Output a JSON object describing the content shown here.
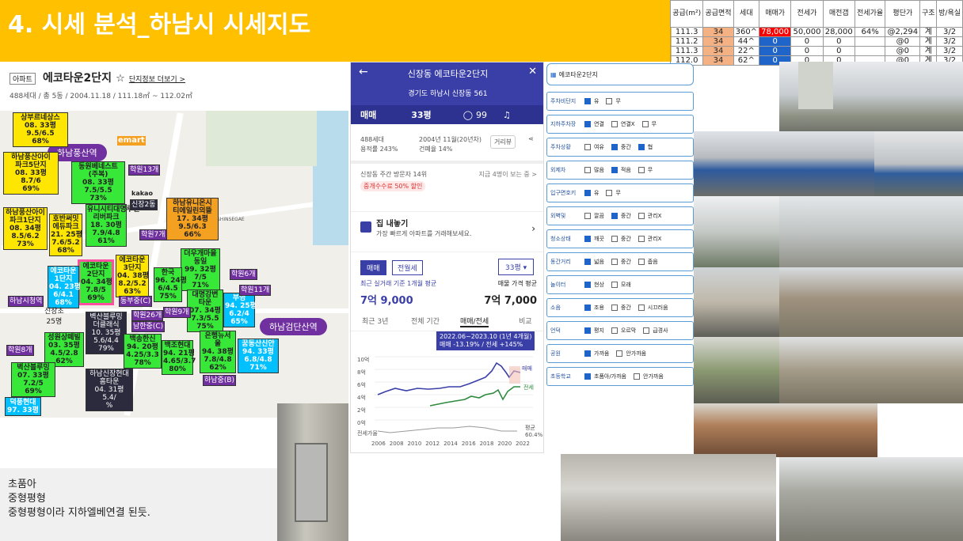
{
  "title": "4. 시세 분석_하남시 시세지도",
  "table": {
    "headers": [
      "공급(m²)",
      "공급면적",
      "세대",
      "매매가",
      "전세가",
      "매전갭",
      "전세가율",
      "평단가",
      "구조",
      "방/욕실"
    ],
    "rows": [
      [
        "111.3",
        "34",
        "360^",
        "78,000",
        "50,000",
        "28,000",
        "64%",
        "@2,294",
        "계",
        "3/2"
      ],
      [
        "111.2",
        "34",
        "44^",
        "0",
        "0",
        "0",
        "",
        "@0",
        "계",
        "3/2"
      ],
      [
        "111.3",
        "34",
        "22^",
        "0",
        "0",
        "0",
        "",
        "@0",
        "계",
        "3/2"
      ],
      [
        "112.0",
        "34",
        "62^",
        "0",
        "0",
        "0",
        "",
        "@0",
        "계",
        "3/2"
      ]
    ]
  },
  "mapinfo": {
    "tag": "아파트",
    "name": "에코타운2단지",
    "link": "단지정보 더보기 >",
    "sub": "488세대 / 총 5동 / 2004.11.18 / 111.18㎡ ~ 112.02㎡"
  },
  "map": {
    "stations": [
      "하남풍산역",
      "하남시청역",
      "하남검단산역"
    ],
    "mart": "emart",
    "kakao": "kakao",
    "shinsegae": "SHINSEGAE",
    "labels": [
      {
        "t": "상부르네상스\n08. 33평\n9.5/6.5\n68%"
      },
      {
        "t": "하남풍산아이\n파크5단지\n08. 33평\n8.7/6\n69%"
      },
      {
        "t": "동원베네스트\n(주복)\n08. 33평\n7.5/5.5\n73%"
      },
      {
        "t": "학원13개"
      },
      {
        "t": "하남풍산아이\n파크1단지\n08. 34평\n8.5/6.2\n73%"
      },
      {
        "t": "유니시티대명루첸\n리버파크\n18. 30평\n7.9/4.8\n61%"
      },
      {
        "t": "하남유니온시\n티에일린의뜰\n17. 34평\n9.5/6.3\n66%"
      },
      {
        "t": "신장2동"
      },
      {
        "t": "호반써밋\n에듀파크\n21. 25평\n7.6/5.2\n68%"
      },
      {
        "t": "학원7개"
      },
      {
        "t": "에코타운\n2단지\n04. 34평\n7.8/5\n69%"
      },
      {
        "t": "에코타운\n3단지\n04. 38평\n8.2/5.2\n63%"
      },
      {
        "t": "더우개마을\n동일\n99. 32평\n7/5\n71%"
      },
      {
        "t": "에코타운\n1단지\n04. 23평\n6/4.1\n68%"
      },
      {
        "t": "한국\n96. 24평\n6/4.5\n75%"
      },
      {
        "t": "학원6개"
      },
      {
        "t": "하남시청역"
      },
      {
        "t": "동부중(C)"
      },
      {
        "t": "대명강변\n타운\n07. 34평\n7.3/5.5\n75%"
      },
      {
        "t": "부영\n94. 25평\n6.2/4\n65%"
      },
      {
        "t": "벽산블루밍\n더클래식\n10. 35평\n5.6/4.4\n79%"
      },
      {
        "t": "남한중(C)"
      },
      {
        "t": "학원26개"
      },
      {
        "t": "학원9개"
      },
      {
        "t": "성원상떼빌\n03. 35평\n4.5/2.8\n62%"
      },
      {
        "t": "백송한신\n94. 20평\n4.25/3.3\n78%"
      },
      {
        "t": "백조현대\n94. 21평\n4.65/3.7\n80%"
      },
      {
        "t": "은행뉴서\n울\n94. 38평\n7.8/4.8\n62%"
      },
      {
        "t": "꿈동산신안\n94. 33평\n6.8/4.8\n71%"
      },
      {
        "t": "학원8개"
      },
      {
        "t": "벽산블루밍\n07. 33평\n7.2/5\n69%"
      },
      {
        "t": "하남신장현대\n홈타운\n04. 31평\n5.4/\n%"
      },
      {
        "t": "하남중(B)"
      },
      {
        "t": "덕풍현대\n97. 33평"
      },
      {
        "t": "신장초\n25명"
      },
      {
        "t": "학원11개"
      }
    ]
  },
  "note": [
    "초품아",
    "중형평형",
    "중형평형이라 지하엘베연결 된듯."
  ],
  "app": {
    "header_title": "신장동 에코타운2단지",
    "address": "경기도 하남시 신장동 561",
    "trade": "매매",
    "size": "33평",
    "comments": "99",
    "households": "488세대",
    "ratio": "용적률 243%",
    "built": "2004년 11월(20년차)",
    "bcr": "건폐율 14%",
    "review": "거리뷰",
    "visitors": "신장동 주간 방문자 14위",
    "visitors_right": "지금 4명이 보는 중 >",
    "discount": "중개수수료 50% 할인",
    "sell_title": "집 내놓기",
    "sell_sub": "가장 빠르게 아파트를 거래해보세요.",
    "tab1": "매매",
    "tab2": "전월세",
    "sel": "33평",
    "recent": "최근 실거래 기준 1개월 평균",
    "recent_val": "7억 9,000",
    "ask": "매물 가격 평균",
    "ask_val": "7억 7,000",
    "periods": [
      "최근 3년",
      "전체 기간",
      "매매/전세",
      "비교"
    ],
    "tooltip1": "2022.06~2023.10 (1년 4개월)",
    "tooltip2": "매매 -13.19% / 전세 +145%",
    "yticks": [
      "10억",
      "8억",
      "6억",
      "4억",
      "2억",
      "0억"
    ],
    "xticks": [
      "2006",
      "2008",
      "2010",
      "2012",
      "2014",
      "2016",
      "2018",
      "2020",
      "2022"
    ],
    "jeonse_label": "전세가율",
    "legend_meme": "매매",
    "legend_js": "전세",
    "avg": "평균",
    "avg_pct": "60.4%"
  },
  "checklist": {
    "title": "에코타운2단지",
    "rows": [
      {
        "k": "주차비단지",
        "opts": [
          [
            "유",
            true
          ],
          [
            "무",
            false
          ]
        ]
      },
      {
        "k": "지하주차장",
        "opts": [
          [
            "연결",
            true
          ],
          [
            "연결X",
            false
          ],
          [
            "무",
            false
          ]
        ]
      },
      {
        "k": "주차상황",
        "opts": [
          [
            "여유",
            false
          ],
          [
            "중간",
            true
          ],
          [
            "협",
            true
          ]
        ]
      },
      {
        "k": "외제차",
        "opts": [
          [
            "많음",
            false
          ],
          [
            "적음",
            true
          ],
          [
            "무",
            false
          ]
        ]
      },
      {
        "k": "입구면호키",
        "opts": [
          [
            "유",
            true
          ],
          [
            "무",
            false
          ]
        ]
      },
      {
        "k": "외벽및",
        "opts": [
          [
            "깔끔",
            false
          ],
          [
            "중간",
            true
          ],
          [
            "관리X",
            false
          ]
        ]
      },
      {
        "k": "청소상태",
        "opts": [
          [
            "깨끗",
            true
          ],
          [
            "중간",
            false
          ],
          [
            "관리X",
            false
          ]
        ]
      },
      {
        "k": "동간거리",
        "opts": [
          [
            "넓음",
            true
          ],
          [
            "중간",
            false
          ],
          [
            "좁음",
            false
          ]
        ]
      },
      {
        "k": "놀이터",
        "opts": [
          [
            "현상",
            true
          ],
          [
            "모래",
            false
          ]
        ]
      },
      {
        "k": "소음",
        "opts": [
          [
            "조용",
            true
          ],
          [
            "중간",
            false
          ],
          [
            "시끄러움",
            false
          ]
        ]
      },
      {
        "k": "언덕",
        "opts": [
          [
            "평지",
            true
          ],
          [
            "오르막",
            false
          ],
          [
            "급경사",
            false
          ]
        ]
      },
      {
        "k": "공원",
        "opts": [
          [
            "가까움",
            true
          ],
          [
            "안가까움",
            false
          ]
        ]
      },
      {
        "k": "초등학교",
        "opts": [
          [
            "초품아/가까움",
            true
          ],
          [
            "안가까움",
            false
          ]
        ]
      }
    ]
  }
}
